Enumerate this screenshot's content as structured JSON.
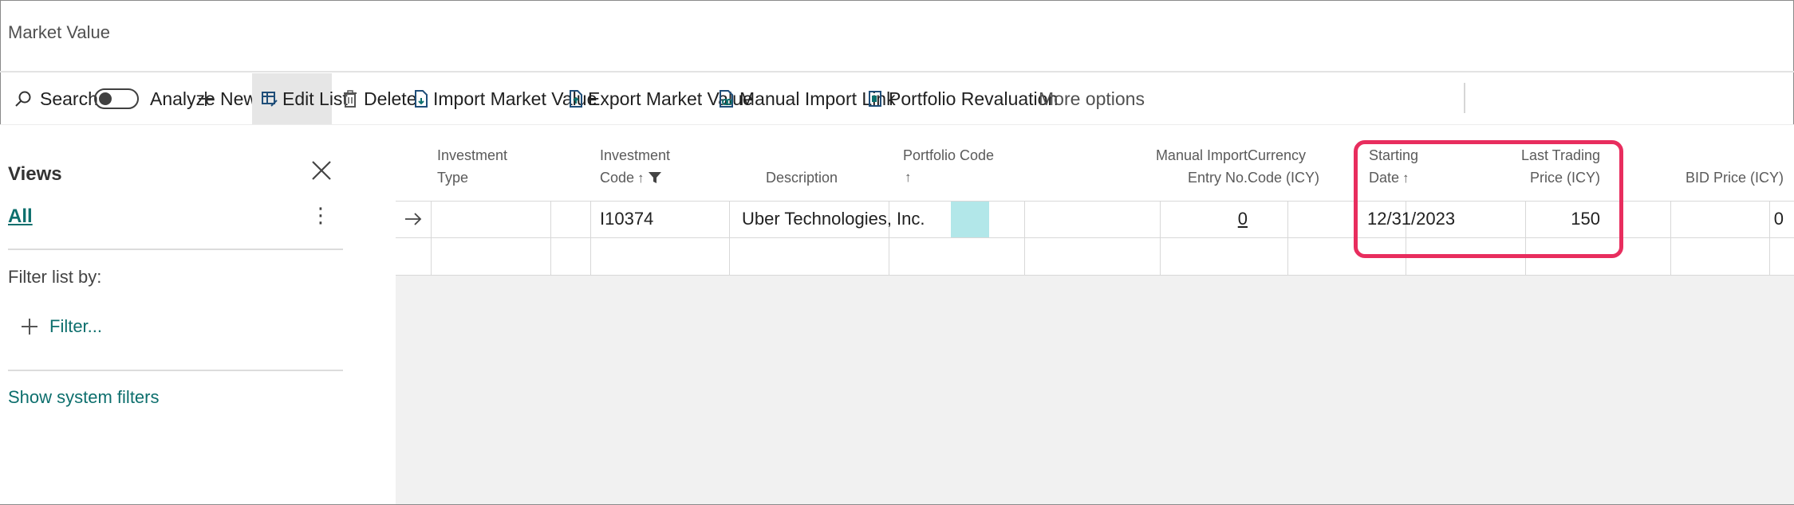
{
  "page": {
    "title": "Market Value"
  },
  "actions": {
    "search": "Search",
    "analyze": "Analyze",
    "new": "New",
    "edit_list": "Edit List",
    "delete": "Delete",
    "import_market_value": "Import Market Value",
    "export_market_value": "Export Market Value",
    "manual_import_link": "Manual Import Link",
    "portfolio_revaluation": "Portfolio Revaluation",
    "more_options": "More options"
  },
  "views": {
    "title": "Views",
    "all": "All",
    "more_glyph": "⋮",
    "filter_list_by": "Filter list by:",
    "filter": "Filter...",
    "show_system_filters": "Show system filters"
  },
  "columns": {
    "investment_type": [
      "Investment",
      "Type"
    ],
    "investment_code": [
      "Investment",
      "Code"
    ],
    "description": "Description",
    "portfolio_code": "Portfolio Code",
    "manual_import_entry_no": [
      "Manual Import",
      "Entry No."
    ],
    "currency_code": [
      "Currency",
      "Code (ICY)"
    ],
    "starting_date": [
      "Starting",
      "Date"
    ],
    "last_trading_price": [
      "Last Trading",
      "Price (ICY)"
    ],
    "bid_price": "BID Price (ICY)",
    "sort_glyph": "↑"
  },
  "rows": [
    {
      "investment_type": "",
      "investment_code": "I10374",
      "description": "Uber Technologies, Inc.",
      "portfolio_code": "",
      "manual_import_entry_no": "0",
      "currency_code": "",
      "starting_date": "12/31/2023",
      "last_trading_price": "150",
      "bid_price": "0"
    }
  ],
  "colors": {
    "accent": "#0d6f6d",
    "highlight": "#e82d5e",
    "selected_cell": "#b2e7e9"
  }
}
